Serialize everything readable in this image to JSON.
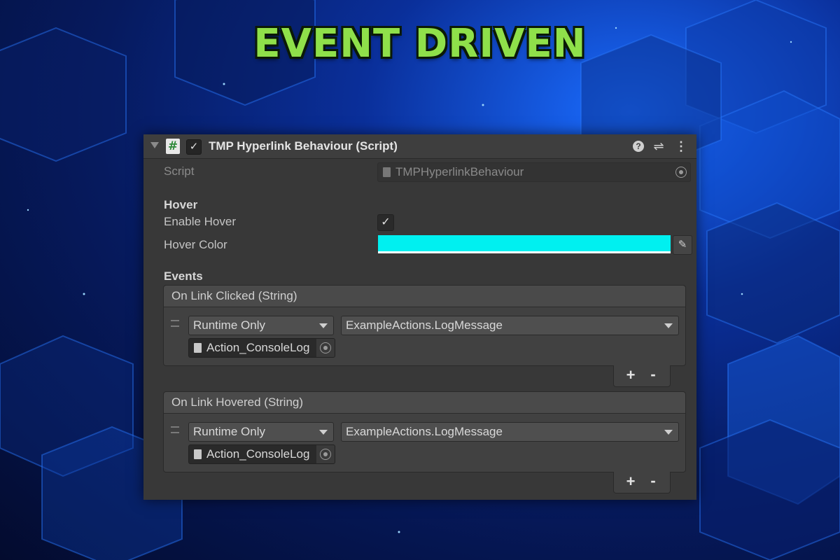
{
  "banner": {
    "title": "EVENT DRIVEN"
  },
  "component": {
    "title": "TMP Hyperlink Behaviour (Script)",
    "enabled": true,
    "script": {
      "label": "Script",
      "value": "TMPHyperlinkBehaviour"
    },
    "hover": {
      "section_label": "Hover",
      "enable_label": "Enable Hover",
      "enabled": true,
      "color_label": "Hover Color",
      "color_value": "#00F0F0"
    },
    "events": {
      "section_label": "Events",
      "list": [
        {
          "title": "On Link Clicked (String)",
          "mode": "Runtime Only",
          "function": "ExampleActions.LogMessage",
          "object": "Action_ConsoleLog"
        },
        {
          "title": "On Link Hovered (String)",
          "mode": "Runtime Only",
          "function": "ExampleActions.LogMessage",
          "object": "Action_ConsoleLog"
        }
      ]
    },
    "buttons": {
      "add": "+",
      "remove": "-"
    }
  }
}
